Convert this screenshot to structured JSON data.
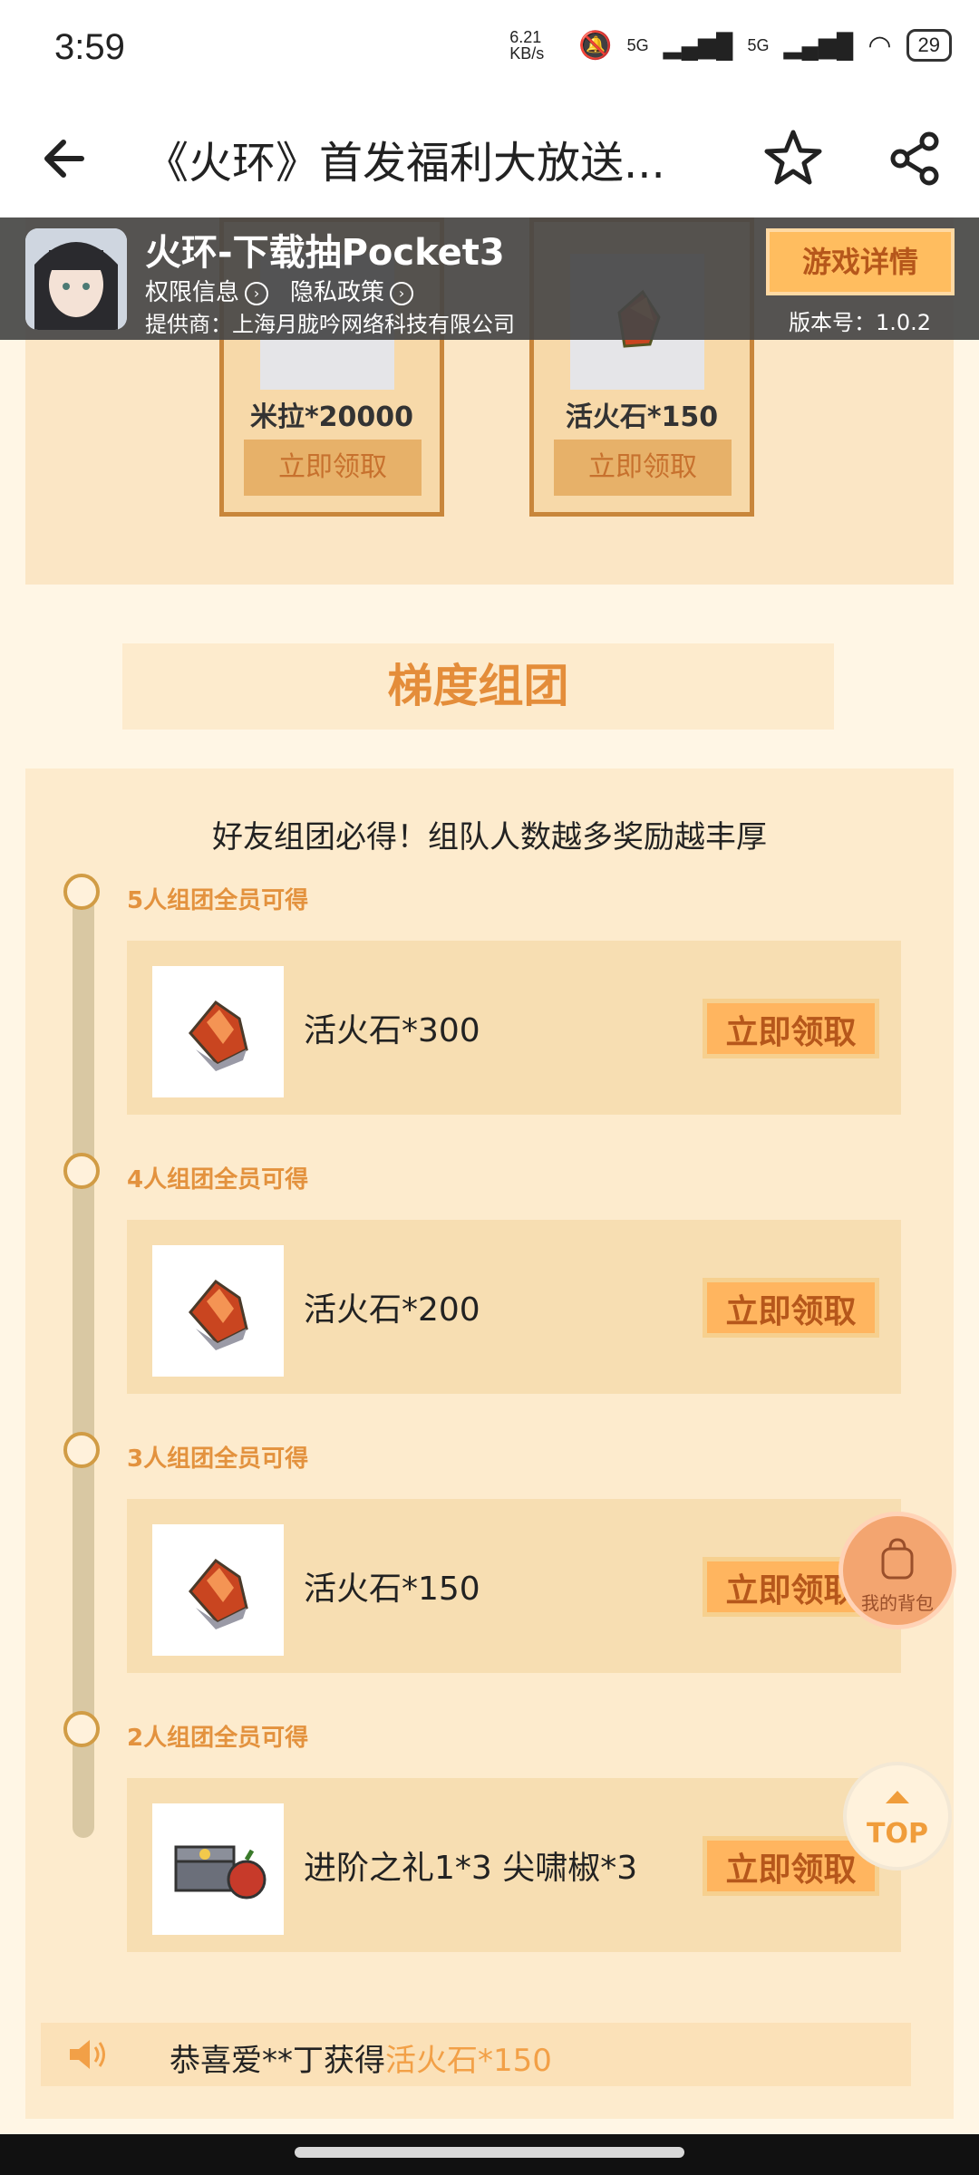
{
  "status": {
    "time": "3:59",
    "net_speed": "6.21 KB/s",
    "signal1": "5G",
    "signal2": "5G",
    "battery": "29"
  },
  "header": {
    "title": "《火环》首发福利大放送..."
  },
  "app_banner": {
    "name": "火环-下载抽Pocket3",
    "permissions": "权限信息",
    "privacy": "隐私政策",
    "provider": "提供商：上海月胧吟网络科技有限公司",
    "detail_button": "游戏详情",
    "version": "版本号：1.0.2"
  },
  "login_rewards": [
    {
      "reward": "米拉*20000",
      "button": "立即领取"
    },
    {
      "reward": "活火石*150",
      "button": "立即领取"
    }
  ],
  "team": {
    "section_title": "梯度组团",
    "heading": "好友组团必得！组队人数越多奖励越丰厚",
    "tiers": [
      {
        "label": "5人组团全员可得",
        "reward": "活火石*300",
        "button": "立即领取"
      },
      {
        "label": "4人组团全员可得",
        "reward": "活火石*200",
        "button": "立即领取"
      },
      {
        "label": "3人组团全员可得",
        "reward": "活火石*150",
        "button": "立即领取"
      },
      {
        "label": "2人组团全员可得",
        "reward": "进阶之礼1*3   尖啸椒*3",
        "button": "立即领取"
      }
    ]
  },
  "ticker": {
    "prefix": "恭喜爱**丁获得",
    "highlight": "活火石*150"
  },
  "floating": {
    "bag_label": "我的背包",
    "top_label": "TOP"
  },
  "colors": {
    "accent": "#e48d3a",
    "button": "#ffb55f",
    "panel": "#fdebcd"
  }
}
